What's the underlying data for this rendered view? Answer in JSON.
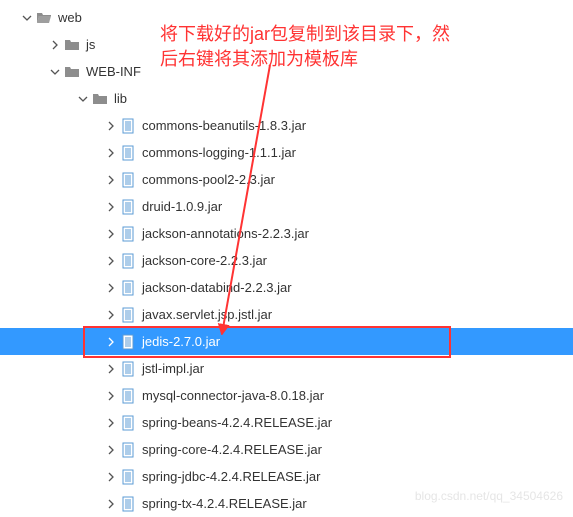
{
  "annotation": {
    "line1": "将下载好的jar包复制到该目录下，然",
    "line2": "后右键将其添加为模板库"
  },
  "watermark": "blog.csdn.net/qq_34504626",
  "tree": [
    {
      "depth": 0,
      "toggle": "down",
      "icon": "folder-open",
      "label": "web"
    },
    {
      "depth": 1,
      "toggle": "right",
      "icon": "folder",
      "label": "js"
    },
    {
      "depth": 1,
      "toggle": "down",
      "icon": "folder",
      "label": "WEB-INF"
    },
    {
      "depth": 2,
      "toggle": "down",
      "icon": "folder",
      "label": "lib"
    },
    {
      "depth": 3,
      "toggle": "right",
      "icon": "file",
      "label": "commons-beanutils-1.8.3.jar"
    },
    {
      "depth": 3,
      "toggle": "right",
      "icon": "file",
      "label": "commons-logging-1.1.1.jar"
    },
    {
      "depth": 3,
      "toggle": "right",
      "icon": "file",
      "label": "commons-pool2-2.3.jar"
    },
    {
      "depth": 3,
      "toggle": "right",
      "icon": "file",
      "label": "druid-1.0.9.jar"
    },
    {
      "depth": 3,
      "toggle": "right",
      "icon": "file",
      "label": "jackson-annotations-2.2.3.jar"
    },
    {
      "depth": 3,
      "toggle": "right",
      "icon": "file",
      "label": "jackson-core-2.2.3.jar"
    },
    {
      "depth": 3,
      "toggle": "right",
      "icon": "file",
      "label": "jackson-databind-2.2.3.jar"
    },
    {
      "depth": 3,
      "toggle": "right",
      "icon": "file",
      "label": "javax.servlet.jsp.jstl.jar"
    },
    {
      "depth": 3,
      "toggle": "right",
      "icon": "file",
      "label": "jedis-2.7.0.jar",
      "selected": true
    },
    {
      "depth": 3,
      "toggle": "right",
      "icon": "file",
      "label": "jstl-impl.jar"
    },
    {
      "depth": 3,
      "toggle": "right",
      "icon": "file",
      "label": "mysql-connector-java-8.0.18.jar"
    },
    {
      "depth": 3,
      "toggle": "right",
      "icon": "file",
      "label": "spring-beans-4.2.4.RELEASE.jar"
    },
    {
      "depth": 3,
      "toggle": "right",
      "icon": "file",
      "label": "spring-core-4.2.4.RELEASE.jar"
    },
    {
      "depth": 3,
      "toggle": "right",
      "icon": "file",
      "label": "spring-jdbc-4.2.4.RELEASE.jar"
    },
    {
      "depth": 3,
      "toggle": "right",
      "icon": "file",
      "label": "spring-tx-4.2.4.RELEASE.jar"
    }
  ]
}
